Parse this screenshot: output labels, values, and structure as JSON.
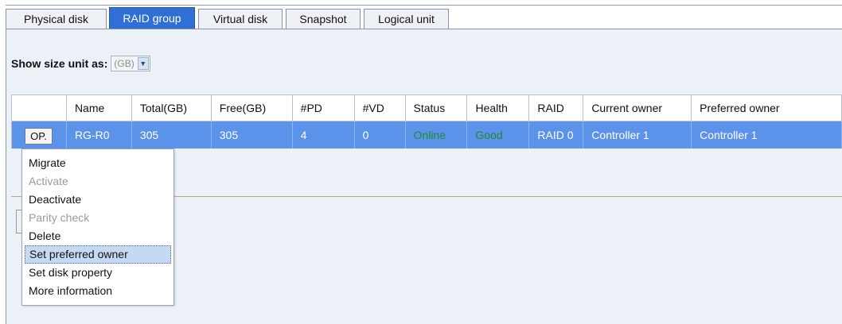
{
  "tabs": [
    {
      "label": "Physical disk"
    },
    {
      "label": "RAID group"
    },
    {
      "label": "Virtual disk"
    },
    {
      "label": "Snapshot"
    },
    {
      "label": "Logical unit"
    }
  ],
  "size_unit": {
    "label": "Show size unit as:",
    "value": "(GB)"
  },
  "table": {
    "headers": [
      "",
      "Name",
      "Total(GB)",
      "Free(GB)",
      "#PD",
      "#VD",
      "Status",
      "Health",
      "RAID",
      "Current owner",
      "Preferred owner"
    ],
    "row": {
      "op": "OP.",
      "name": "RG-R0",
      "total": "305",
      "free": "305",
      "pd": "4",
      "vd": "0",
      "status": "Online",
      "health": "Good",
      "raid": "RAID 0",
      "current_owner": "Controller 1",
      "preferred_owner": "Controller 1"
    }
  },
  "menu": {
    "items": [
      {
        "label": "Migrate",
        "enabled": true
      },
      {
        "label": "Activate",
        "enabled": false
      },
      {
        "label": "Deactivate",
        "enabled": true
      },
      {
        "label": "Parity check",
        "enabled": false
      },
      {
        "label": "Delete",
        "enabled": true
      },
      {
        "label": "Set preferred owner",
        "enabled": true,
        "selected": true
      },
      {
        "label": "Set disk property",
        "enabled": true
      },
      {
        "label": "More information",
        "enabled": true
      }
    ]
  },
  "colors": {
    "tab_active": "#2f6fd6",
    "row_selected": "#5b93ea",
    "status_good": "#1f8a2a",
    "panel_bg": "#ecf1f8"
  }
}
